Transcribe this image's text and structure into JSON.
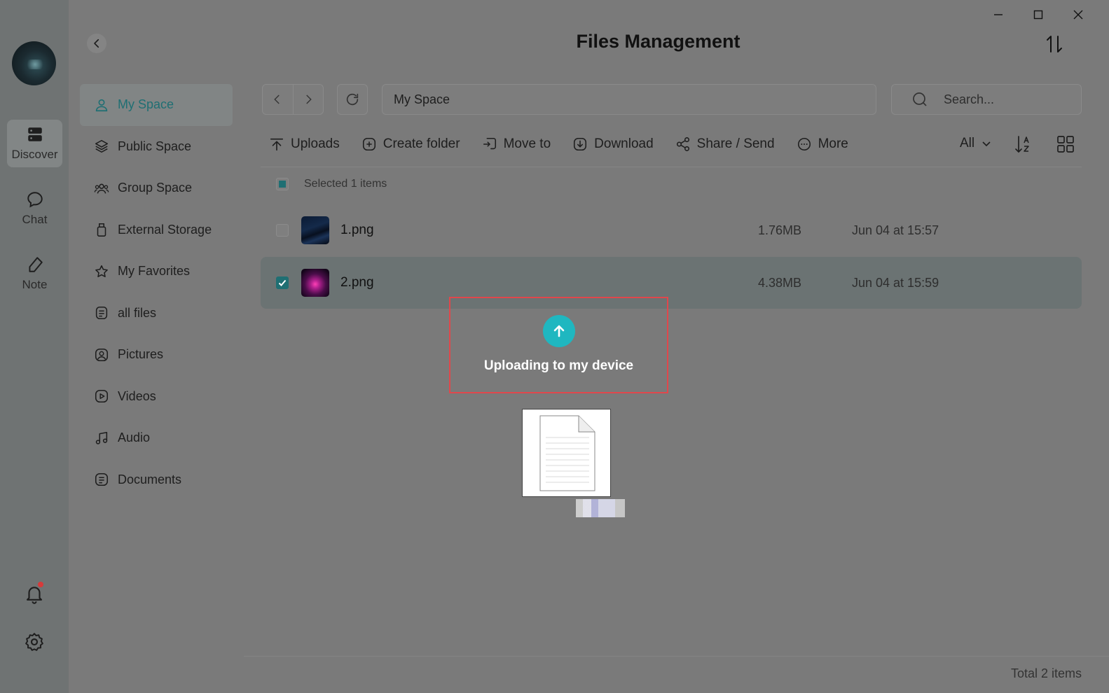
{
  "window": {
    "title": "Files Management"
  },
  "rail": {
    "items": [
      {
        "label": "Discover",
        "icon": "server-icon"
      },
      {
        "label": "Chat",
        "icon": "chat-bubble-icon"
      },
      {
        "label": "Note",
        "icon": "pen-icon"
      }
    ]
  },
  "sidebar": {
    "items": [
      {
        "label": "My Space",
        "icon": "user-icon",
        "active": true
      },
      {
        "label": "Public Space",
        "icon": "layers-icon"
      },
      {
        "label": "Group Space",
        "icon": "group-icon"
      },
      {
        "label": "External Storage",
        "icon": "usb-icon"
      },
      {
        "label": "My Favorites",
        "icon": "star-icon"
      },
      {
        "label": "all files",
        "icon": "files-icon"
      },
      {
        "label": "Pictures",
        "icon": "picture-icon"
      },
      {
        "label": "Videos",
        "icon": "video-icon"
      },
      {
        "label": "Audio",
        "icon": "music-icon"
      },
      {
        "label": "Documents",
        "icon": "document-icon"
      }
    ]
  },
  "pathbar": {
    "path": "My Space",
    "search_placeholder": "Search..."
  },
  "toolbar": {
    "uploads": "Uploads",
    "create_folder": "Create folder",
    "move_to": "Move to",
    "download": "Download",
    "share_send": "Share / Send",
    "more": "More",
    "filter": "All"
  },
  "selection": {
    "text": "Selected 1 items"
  },
  "files": [
    {
      "name": "1.png",
      "size": "1.76MB",
      "date": "Jun 04 at 15:57",
      "checked": false
    },
    {
      "name": "2.png",
      "size": "4.38MB",
      "date": "Jun 04 at 15:59",
      "checked": true
    }
  ],
  "drop_zone": {
    "text": "Uploading to my device"
  },
  "footer": {
    "total": "Total 2 items"
  },
  "colors": {
    "accent": "#1f6f73",
    "upload": "#1fb7c0",
    "drop_border": "#e0474c"
  }
}
